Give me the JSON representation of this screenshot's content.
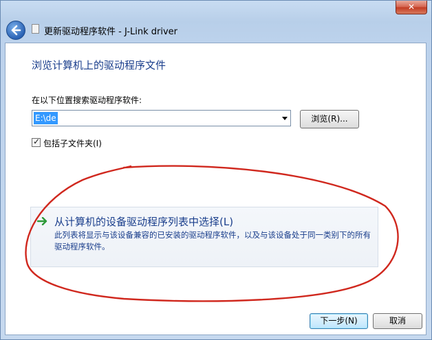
{
  "window": {
    "title": "更新驱动程序软件 - J-Link driver",
    "close_glyph": "✕"
  },
  "page": {
    "heading": "浏览计算机上的驱动程序文件",
    "search_label": "在以下位置搜索驱动程序软件:",
    "path_value": "E:\\de",
    "browse_label": "浏览(R)...",
    "include_subfolders_label": "包括子文件夹(I)",
    "include_subfolders_checked": true
  },
  "option": {
    "title": "从计算机的设备驱动程序列表中选择(L)",
    "description": "此列表将显示与该设备兼容的已安装的驱动程序软件，以及与该设备处于同一类别下的所有驱动程序软件。"
  },
  "footer": {
    "next_label": "下一步(N)",
    "cancel_label": "取消"
  },
  "colors": {
    "accent": "#1a3e8c",
    "selection": "#3399ff",
    "annotation": "#d0281e",
    "arrow": "#2e9a3a"
  }
}
